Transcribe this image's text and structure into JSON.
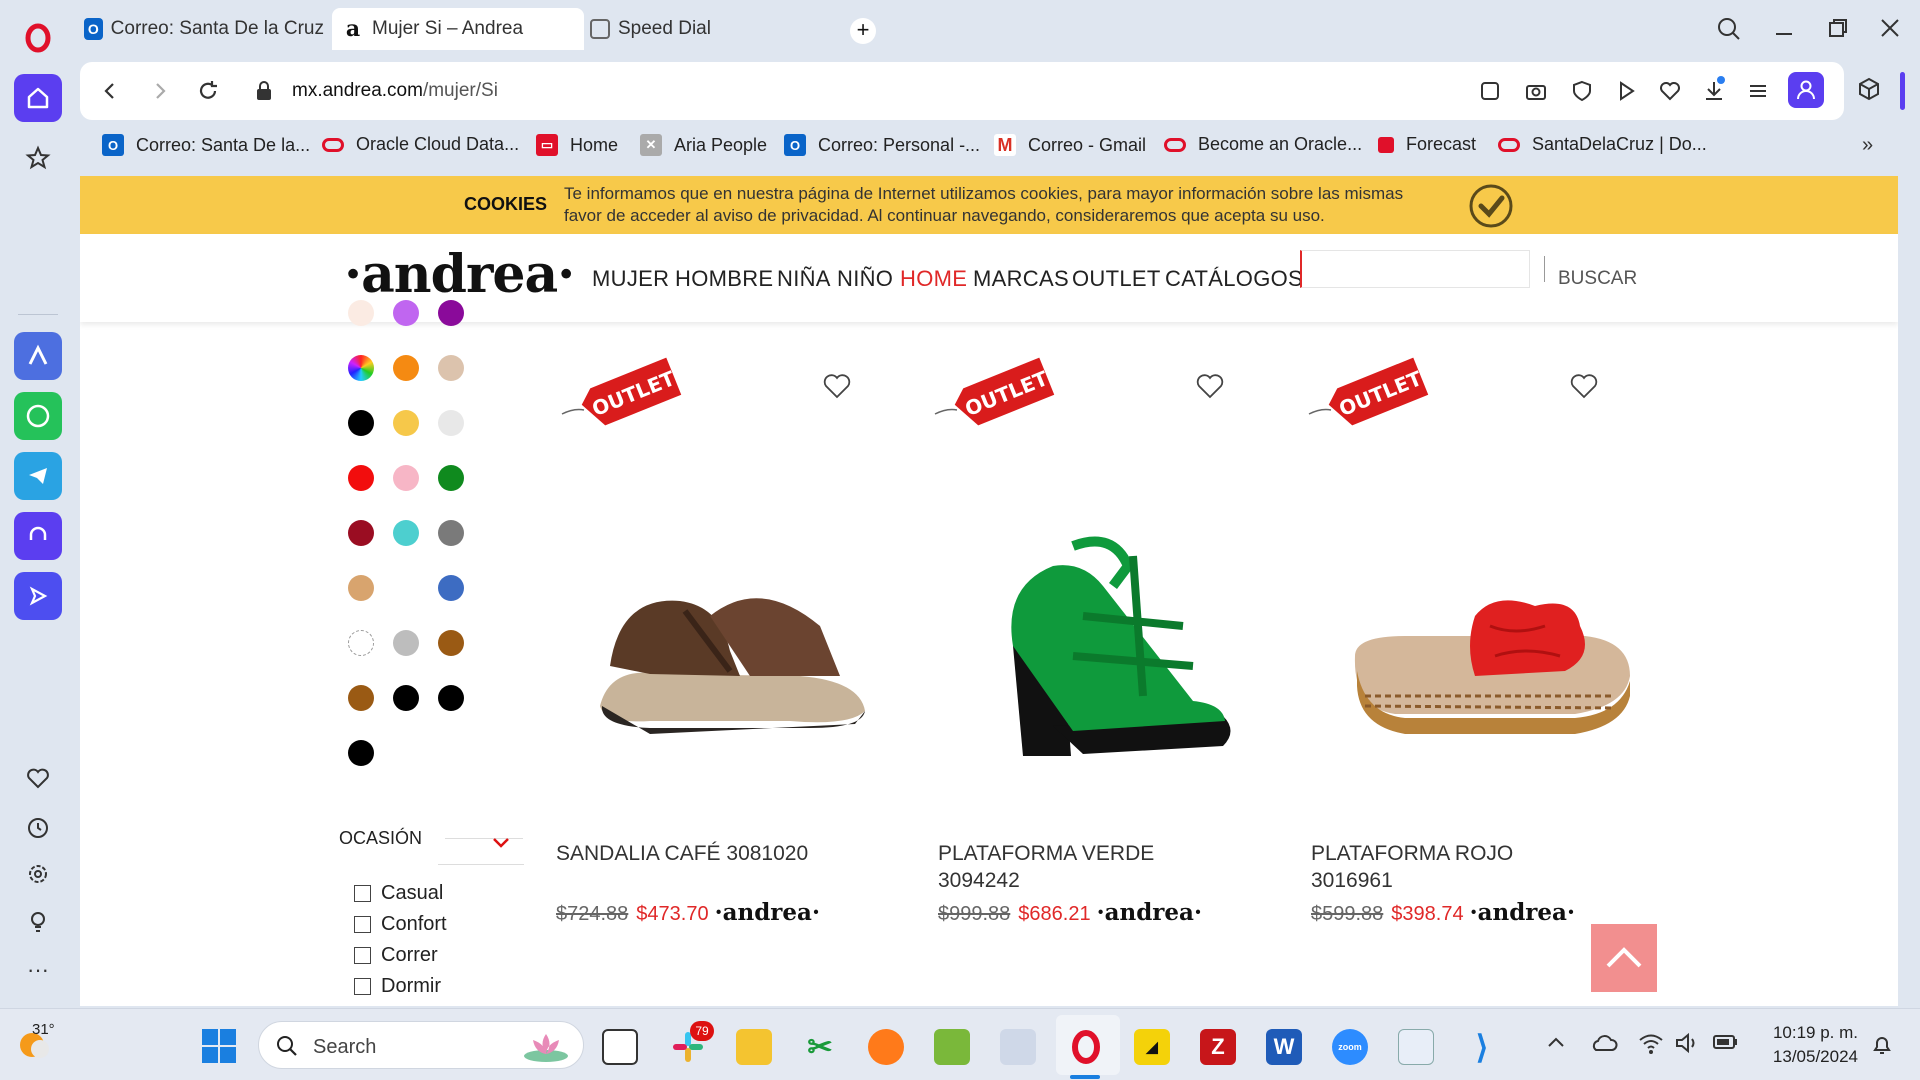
{
  "tabs": [
    {
      "label": "Correo: Santa De la Cruz",
      "icon": "outlook-icon"
    },
    {
      "label": "Mujer Si – Andrea",
      "icon": "andrea-icon"
    },
    {
      "label": "Speed Dial",
      "icon": "grid-icon"
    }
  ],
  "address": {
    "host": "mx.andrea.com",
    "path": "/mujer/Si"
  },
  "bookmarks": [
    {
      "label": "Correo: Santa De la...",
      "icon": "outlook-icon"
    },
    {
      "label": "Oracle Cloud Data...",
      "icon": "oracle-icon"
    },
    {
      "label": "Home",
      "icon": "oracle-icon"
    },
    {
      "label": "Aria People",
      "icon": "aria-icon"
    },
    {
      "label": "Correo: Personal -...",
      "icon": "outlook-icon"
    },
    {
      "label": "Correo - Gmail",
      "icon": "gmail-icon"
    },
    {
      "label": "Become an Oracle...",
      "icon": "oracle-icon"
    },
    {
      "label": "Forecast",
      "icon": "oracle-icon"
    },
    {
      "label": "SantaDelaCruz | Do...",
      "icon": "oracle-icon"
    }
  ],
  "cookie": {
    "title": "COOKIES",
    "line1": "Te informamos que en nuestra página de Internet utilizamos cookies, para mayor información sobre las mismas",
    "line2": "favor de acceder al aviso de privacidad. Al continuar navegando, consideraremos que acepta su uso."
  },
  "site": {
    "logo": "·andrea·",
    "nav": [
      "MUJER",
      "HOMBRE",
      "NIÑA",
      "NIÑO",
      "HOME",
      "MARCAS",
      "OUTLET",
      "CATÁLOGOS"
    ],
    "search_button": "BUSCAR",
    "highlight_color": "#e02828"
  },
  "filters": {
    "occasion_title": "OCASIÓN",
    "occasions": [
      "Casual",
      "Confort",
      "Correr",
      "Dormir"
    ],
    "colors": [
      [
        "#fbebe3",
        "#c066f0",
        "#8a0a9a"
      ],
      [
        "rainbow",
        "#f58a12",
        "#dcc3ad"
      ],
      [
        "#000000",
        "#f6c84a",
        "#e8e8e8"
      ],
      [
        "#f20d0d",
        "#f7b6c6",
        "#0f8a1e"
      ],
      [
        "#9a0d22",
        "#4dcfcf",
        "#7a7a7a"
      ],
      [
        "#d8a46e",
        "none",
        "#3d6cc2"
      ],
      [
        "#ffffff",
        "#bdbdbd",
        "#9a5a14"
      ],
      [
        "#9a5a14",
        "#000000",
        "#000000"
      ],
      [
        "#000000"
      ]
    ]
  },
  "badge": "OUTLET",
  "products": [
    {
      "name1": "SANDALIA CAFÉ 3081020",
      "name2": "",
      "old_price": "$724.88",
      "new_price": "$473.70",
      "brand": "·andrea·"
    },
    {
      "name1": "PLATAFORMA VERDE",
      "name2": "3094242",
      "old_price": "$999.88",
      "new_price": "$686.21",
      "brand": "·andrea·"
    },
    {
      "name1": "PLATAFORMA ROJO",
      "name2": "3016961",
      "old_price": "$599.88",
      "new_price": "$398.74",
      "brand": "·andrea·"
    }
  ],
  "taskbar": {
    "weather": "31°",
    "search_placeholder": "Search",
    "slack_badge": "79",
    "time": "10:19 p. m.",
    "date": "13/05/2024"
  }
}
